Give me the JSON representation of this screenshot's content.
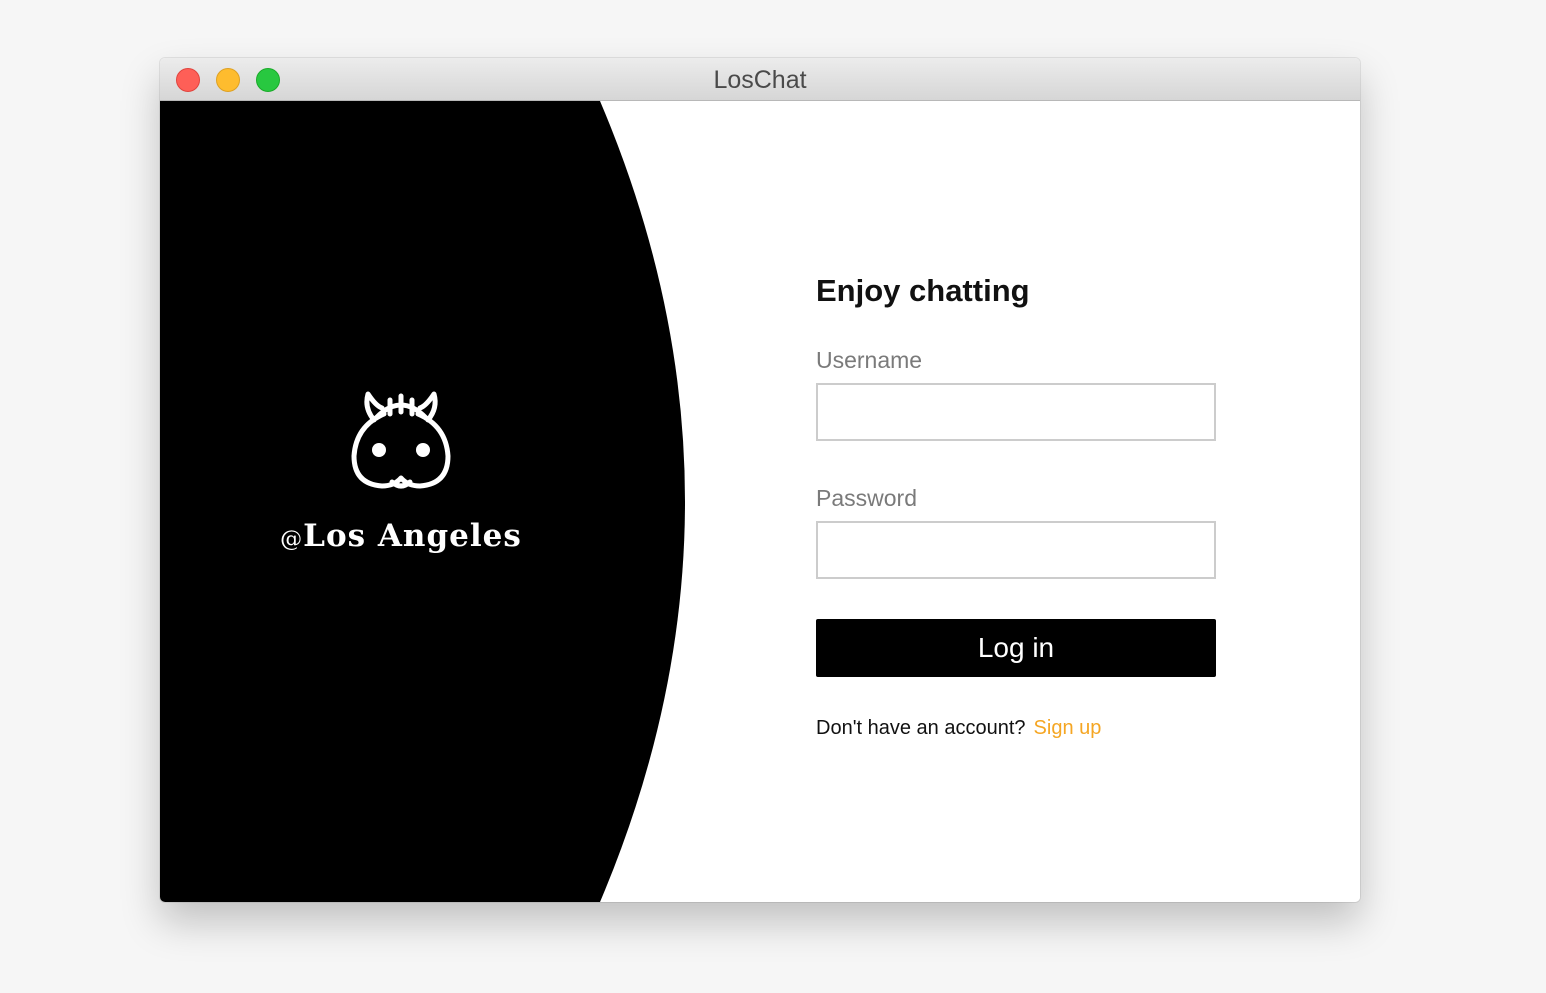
{
  "window": {
    "title": "LosChat"
  },
  "brand": {
    "at_sign": "@",
    "name": "Los Angeles",
    "icon": "cow-head-icon"
  },
  "login": {
    "heading": "Enjoy chatting",
    "username_label": "Username",
    "username_value": "",
    "password_label": "Password",
    "password_value": "",
    "submit_label": "Log in",
    "signup_prompt": "Don't have an account?",
    "signup_link": "Sign up"
  },
  "colors": {
    "panel_background": "#000000",
    "accent_link": "#f5a623",
    "button_background": "#000000",
    "close": "#fe5f57",
    "minimize": "#febc2e",
    "maximize": "#28c840"
  }
}
